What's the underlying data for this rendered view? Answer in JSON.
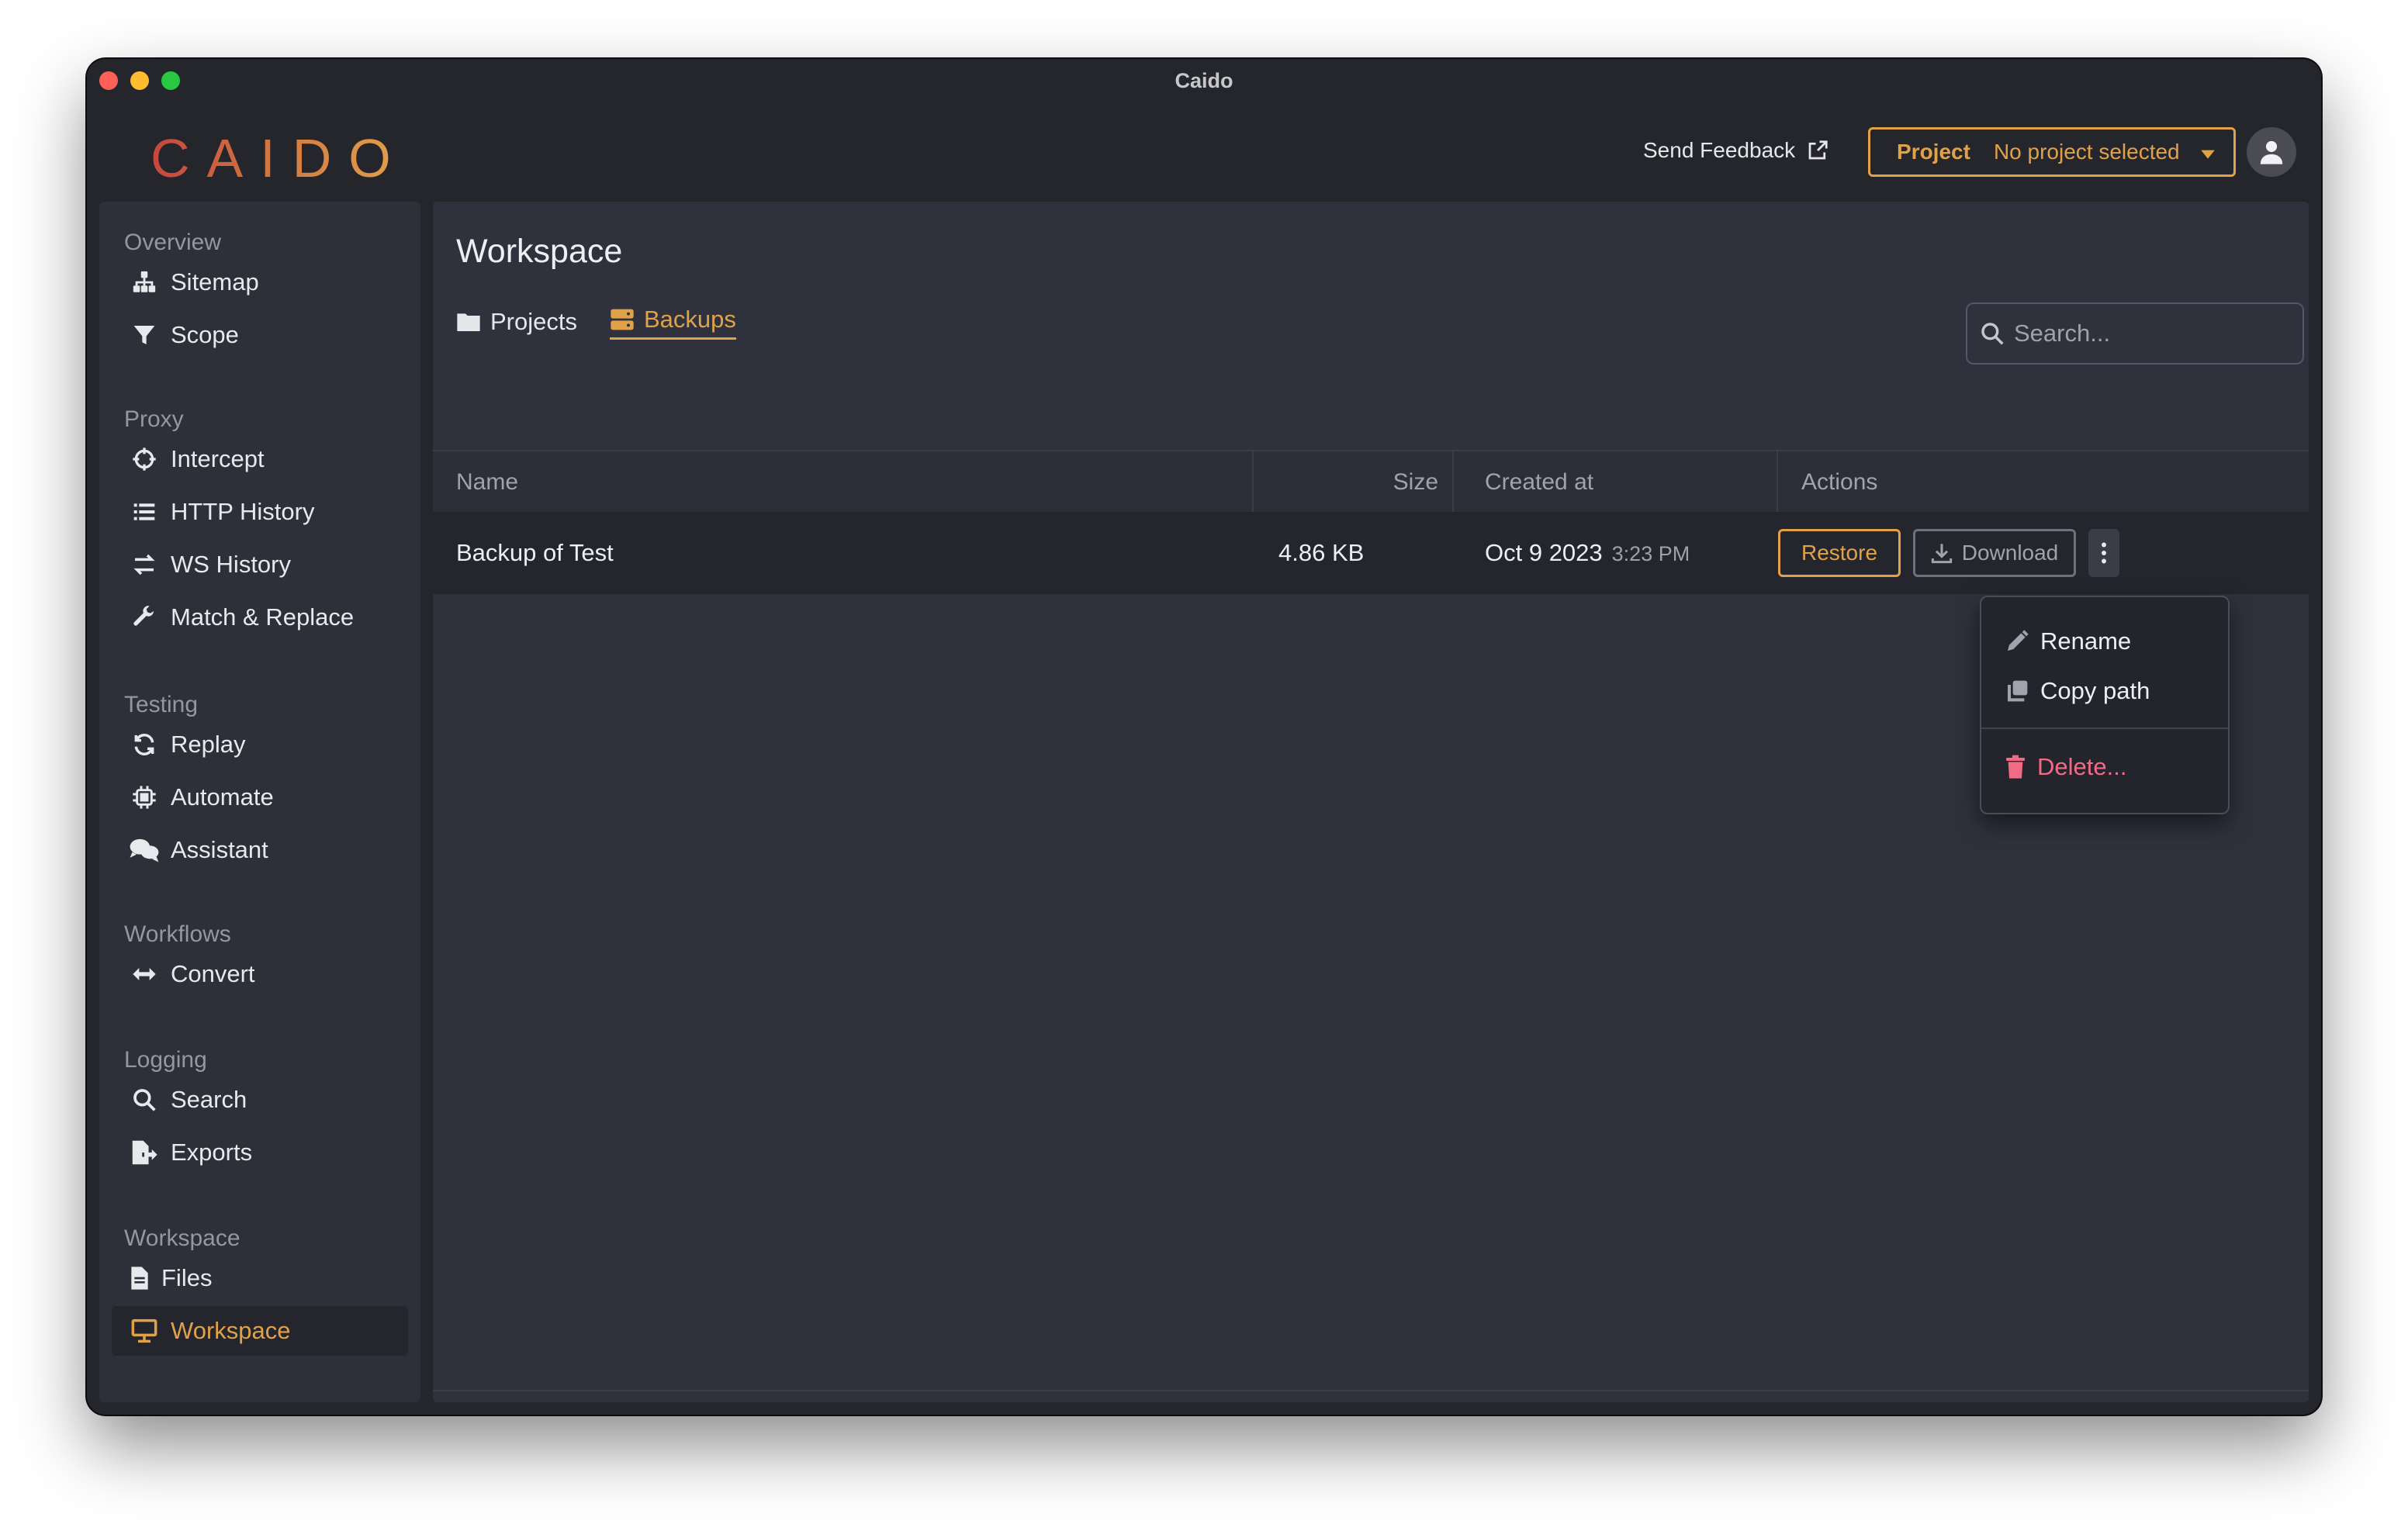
{
  "window": {
    "title": "Caido"
  },
  "header": {
    "logo": "CAIDO",
    "feedback_label": "Send Feedback",
    "project_label": "Project",
    "project_value": "No project selected"
  },
  "sidebar": {
    "sections": [
      {
        "title": "Overview",
        "items": [
          {
            "label": "Sitemap",
            "icon": "sitemap-icon"
          },
          {
            "label": "Scope",
            "icon": "filter-icon"
          }
        ]
      },
      {
        "title": "Proxy",
        "items": [
          {
            "label": "Intercept",
            "icon": "crosshair-icon"
          },
          {
            "label": "HTTP History",
            "icon": "list-icon"
          },
          {
            "label": "WS History",
            "icon": "arrows-exchange-icon"
          },
          {
            "label": "Match & Replace",
            "icon": "wrench-icon"
          }
        ]
      },
      {
        "title": "Testing",
        "items": [
          {
            "label": "Replay",
            "icon": "refresh-icon"
          },
          {
            "label": "Automate",
            "icon": "chip-icon"
          },
          {
            "label": "Assistant",
            "icon": "chat-icon"
          }
        ]
      },
      {
        "title": "Workflows",
        "items": [
          {
            "label": "Convert",
            "icon": "arrows-horizontal-icon"
          }
        ]
      },
      {
        "title": "Logging",
        "items": [
          {
            "label": "Search",
            "icon": "search-icon"
          },
          {
            "label": "Exports",
            "icon": "file-export-icon"
          }
        ]
      },
      {
        "title": "Workspace",
        "items": [
          {
            "label": "Files",
            "icon": "file-icon"
          },
          {
            "label": "Workspace",
            "icon": "monitor-icon",
            "active": true
          }
        ]
      }
    ]
  },
  "main": {
    "title": "Workspace",
    "tabs": [
      {
        "label": "Projects"
      },
      {
        "label": "Backups",
        "active": true
      }
    ],
    "search_placeholder": "Search...",
    "columns": {
      "name": "Name",
      "size": "Size",
      "created": "Created at",
      "actions": "Actions"
    },
    "rows": [
      {
        "name": "Backup of Test",
        "size": "4.86 KB",
        "date": "Oct 9 2023",
        "time": "3:23 PM"
      }
    ],
    "row_actions": {
      "restore": "Restore",
      "download": "Download"
    },
    "menu": {
      "rename": "Rename",
      "copy_path": "Copy path",
      "delete": "Delete..."
    }
  },
  "colors": {
    "accent": "#e0a248",
    "danger": "#f26b85",
    "background": "#2f313c"
  }
}
